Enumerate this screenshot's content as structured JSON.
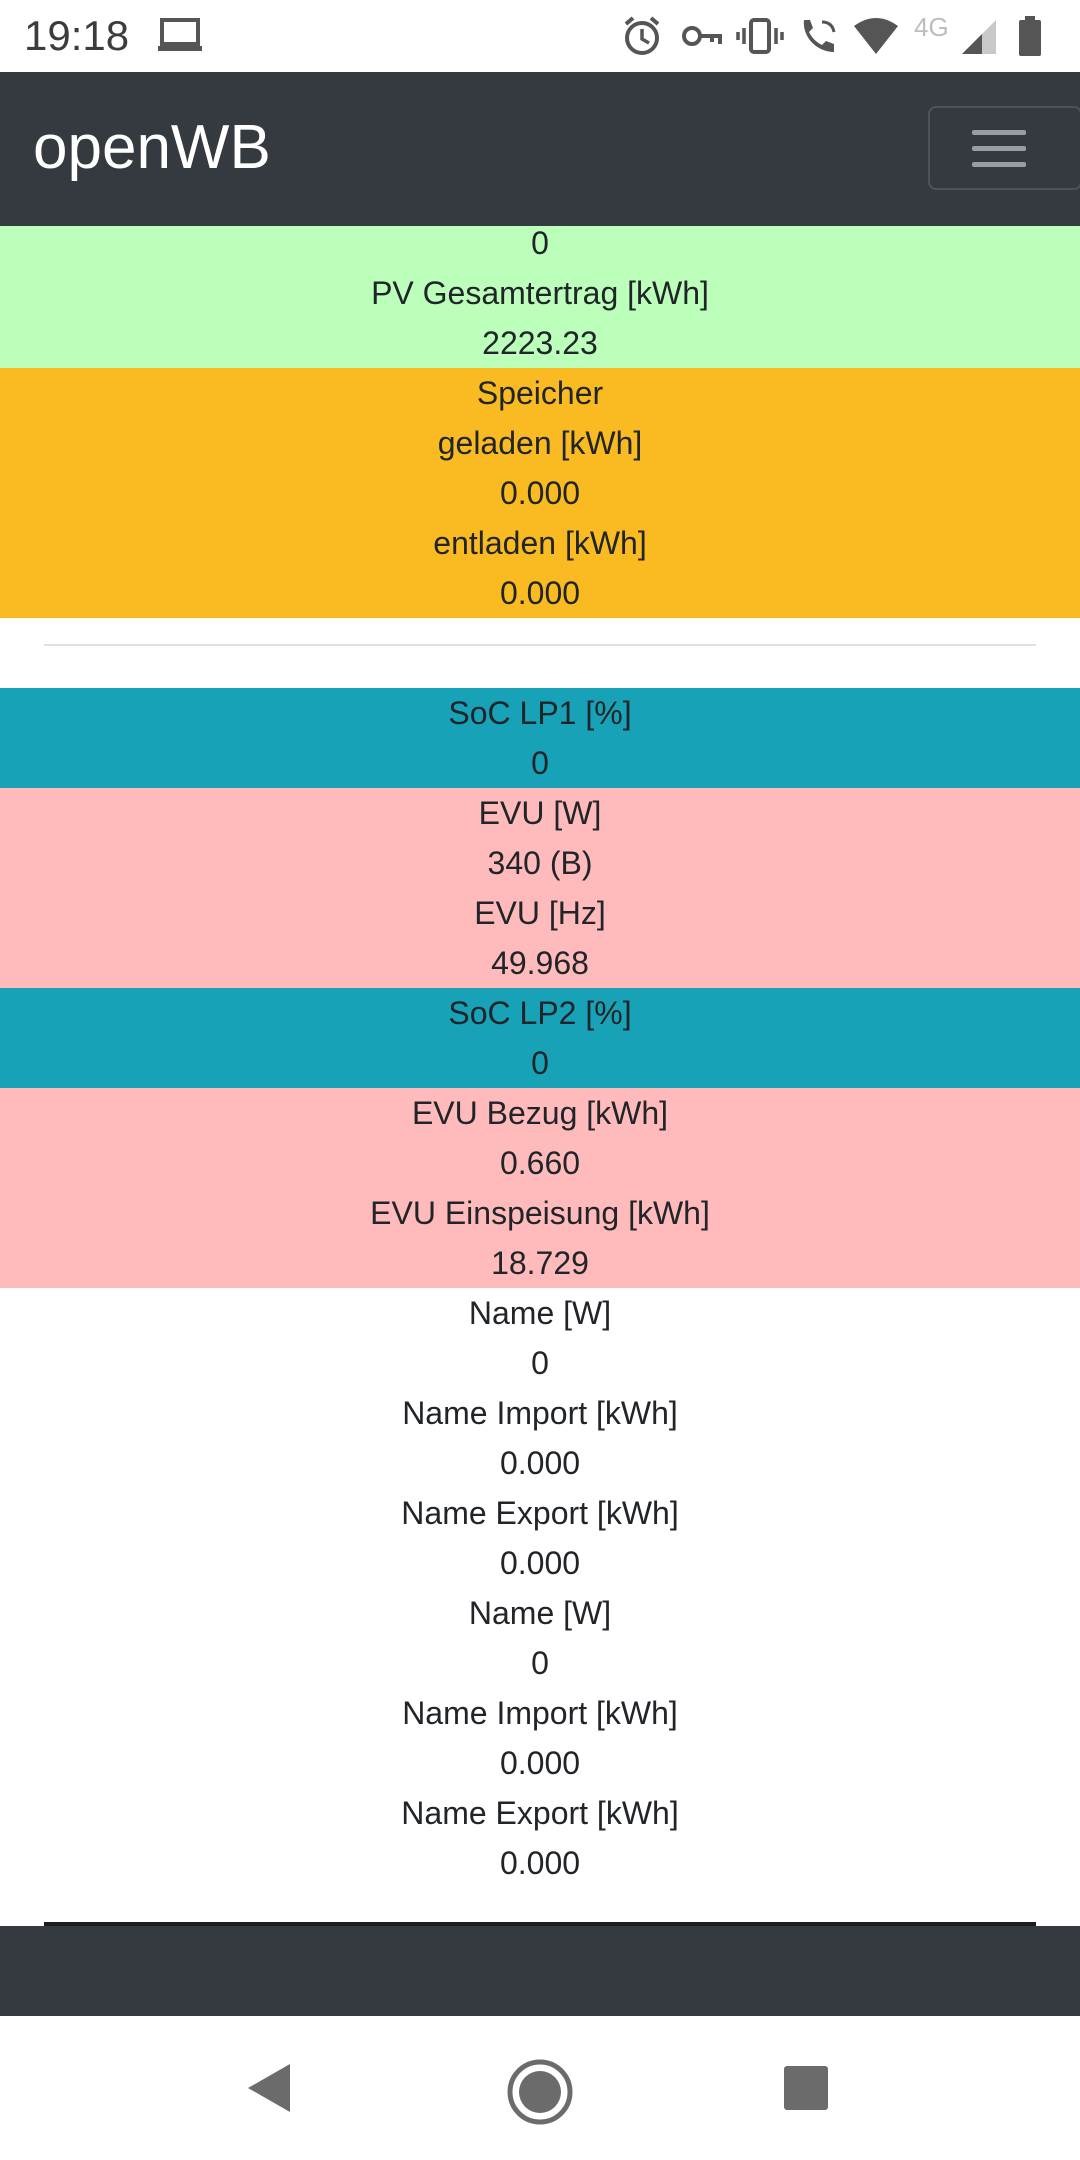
{
  "status_bar": {
    "time": "19:18",
    "network": "4G",
    "icons": [
      "laptop-icon",
      "alarm-icon",
      "vpn-key-icon",
      "vibrate-icon",
      "wifi-call-icon",
      "wifi-icon",
      "signal-icon",
      "battery-icon"
    ]
  },
  "navbar": {
    "brand": "openWB",
    "menu_icon": "hamburger-menu-icon"
  },
  "pv": {
    "value_top": "0",
    "label_total": "PV Gesamtertrag [kWh]",
    "value_total": "2223.23"
  },
  "speicher": {
    "title": "Speicher",
    "label_charged": "geladen [kWh]",
    "value_charged": "0.000",
    "label_discharged": "entladen [kWh]",
    "value_discharged": "0.000"
  },
  "soc_lp1": {
    "label": "SoC LP1 [%]",
    "value": "0"
  },
  "evu": {
    "label_power": "EVU [W]",
    "value_power": "340 (B)",
    "label_freq": "EVU [Hz]",
    "value_freq": "49.968"
  },
  "soc_lp2": {
    "label": "SoC LP2 [%]",
    "value": "0"
  },
  "evu_energy": {
    "label_import": "EVU Bezug [kWh]",
    "value_import": "0.660",
    "label_export": "EVU Einspeisung [kWh]",
    "value_export": "18.729"
  },
  "devices": [
    {
      "power_label": "Name [W]",
      "power_value": "0",
      "import_label": "Name Import [kWh]",
      "import_value": "0.000",
      "export_label": "Name Export [kWh]",
      "export_value": "0.000"
    },
    {
      "power_label": "Name [W]",
      "power_value": "0",
      "import_label": "Name Import [kWh]",
      "import_value": "0.000",
      "export_label": "Name Export [kWh]",
      "export_value": "0.000"
    }
  ],
  "colors": {
    "navbar": "#343a40",
    "pv": "#bbffbb",
    "speicher": "#f9bb21",
    "soc": "#17a2b8",
    "evu": "#ffbbbb"
  }
}
